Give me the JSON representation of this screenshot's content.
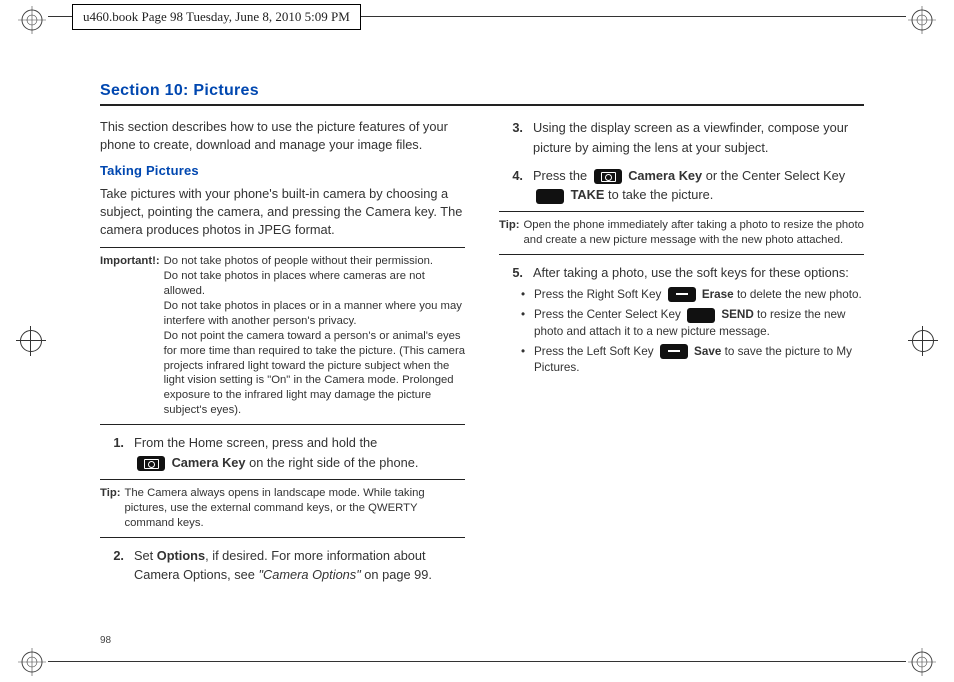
{
  "header": {
    "text": "u460.book  Page 98  Tuesday, June 8, 2010  5:09 PM"
  },
  "page_number": "98",
  "section": {
    "title": "Section 10: Pictures",
    "intro": "This section describes how to use the picture features of your phone to create, download and manage your image files.",
    "subhead_taking": "Taking Pictures",
    "taking_intro": "Take pictures with your phone's built-in camera by choosing a subject, pointing the camera, and pressing the Camera key. The camera produces photos in JPEG format.",
    "important_label": "Important!:",
    "important_lines": [
      "Do not take photos of people without their permission.",
      "Do not take photos in places where cameras are not allowed.",
      "Do not take photos in places or in a manner where you may interfere with another person's privacy.",
      "Do not point the camera toward a person's or animal's eyes for more time than required to take the picture. (This camera projects infrared light toward the picture subject when the light vision setting is \"On\" in the Camera mode.  Prolonged exposure to the infrared light may damage the picture subject's eyes)."
    ],
    "steps": {
      "s1": {
        "num": "1.",
        "a": "From the Home screen, press and hold the ",
        "b": "Camera Key",
        "c": " on the right side of the phone."
      },
      "s2": {
        "num": "2.",
        "a": "Set ",
        "b": "Options",
        "c": ", if desired. For more information about Camera Options, see ",
        "d": "\"Camera Options\"",
        "e": " on page 99."
      },
      "s3": {
        "num": "3.",
        "text": "Using the display screen as a viewfinder, compose your picture by aiming the lens at your subject."
      },
      "s4": {
        "num": "4.",
        "a": "Press the ",
        "b": "Camera Key",
        "c": " or the Center Select Key ",
        "d": "TAKE",
        "e": " to take the picture."
      },
      "s5": {
        "num": "5.",
        "text": "After taking a photo, use the soft keys for these options:"
      }
    },
    "tips": {
      "label": "Tip:",
      "tip1": "The Camera always opens in landscape mode. While taking pictures, use the external command keys, or the QWERTY command keys.",
      "tip2": "Open the phone immediately after taking a photo to resize the photo and create a new picture message with the new photo attached."
    },
    "bullets": {
      "b1": {
        "a": "Press the Right Soft Key ",
        "b": "Erase",
        "c": " to delete the new photo."
      },
      "b2": {
        "a": "Press the Center Select Key ",
        "b": "SEND",
        "c": " to resize the new photo and attach it to a new picture message."
      },
      "b3": {
        "a": "Press the Left Soft Key ",
        "b": "Save",
        "c": " to save the picture to My Pictures."
      }
    }
  }
}
